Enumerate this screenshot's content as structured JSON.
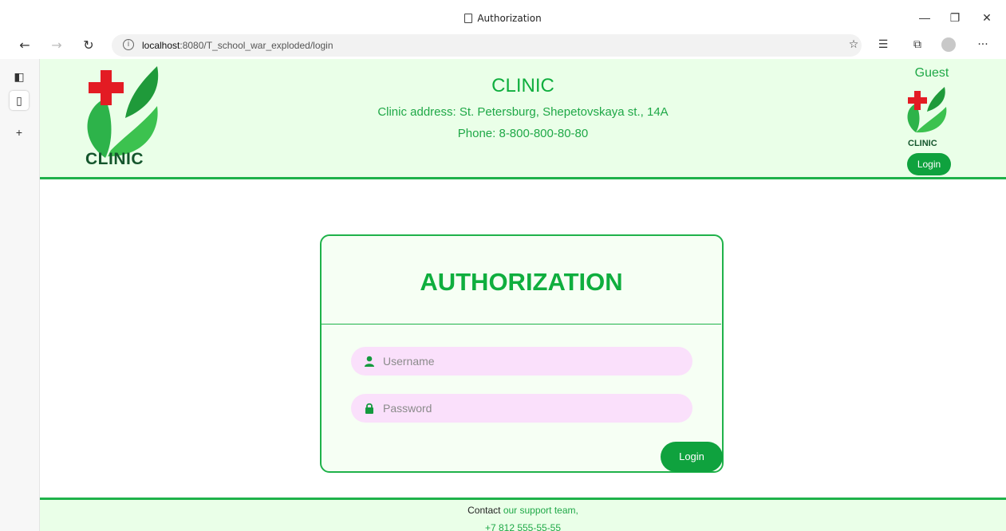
{
  "browser": {
    "tab_title": "Authorization",
    "url_host": "localhost",
    "url_rest": ":8080/T_school_war_exploded/login",
    "controls": {
      "back": "←",
      "forward": "→",
      "refresh": "↻",
      "minimize": "—",
      "restore": "❐",
      "close": "✕",
      "more": "···"
    }
  },
  "header": {
    "logo_text": "CLINIC",
    "title": "CLINIC",
    "address": "Clinic address: St. Petersburg, Shepetovskaya st., 14A",
    "phone": "Phone: 8-800-800-80-80",
    "user_label": "Guest",
    "small_logo_text": "CLINIC",
    "login_label": "Login"
  },
  "auth": {
    "title": "AUTHORIZATION",
    "username_placeholder": "Username",
    "password_placeholder": "Password",
    "submit_label": "Login"
  },
  "footer": {
    "contact_prefix": "Contact ",
    "contact_link": "our support team,",
    "phone": "+7 812 555-55-55"
  },
  "colors": {
    "accent": "#0fae3e",
    "header_bg": "#eaffe8",
    "input_bg": "#fae0fb",
    "button_bg": "#0fa23e"
  }
}
